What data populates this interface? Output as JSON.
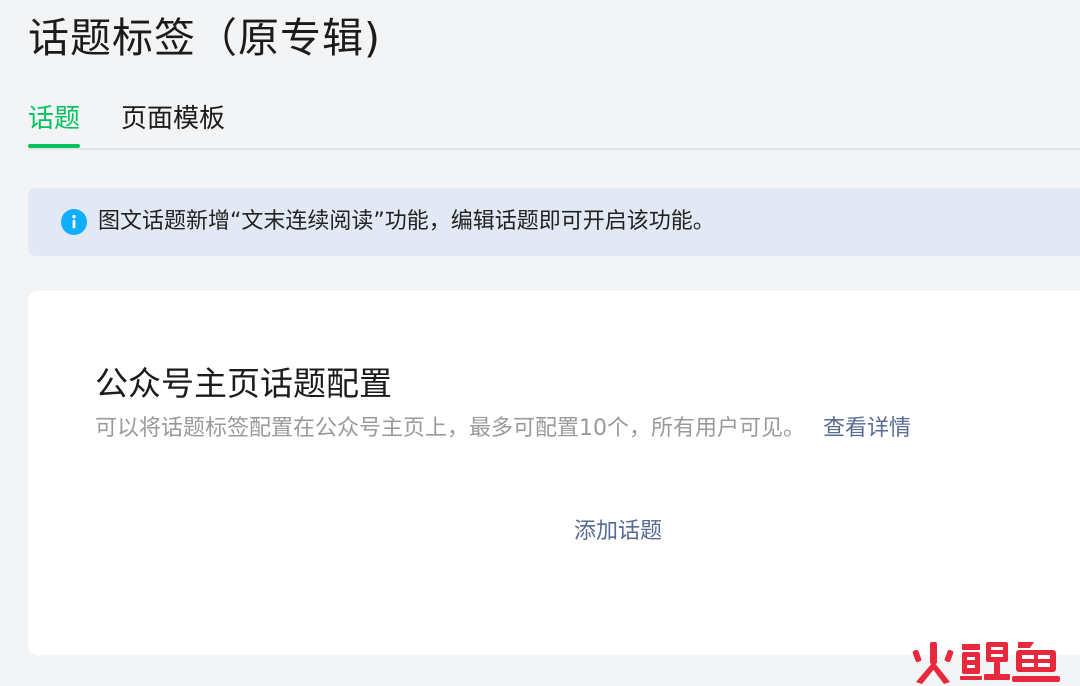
{
  "page": {
    "title": "话题标签（原专辑)"
  },
  "tabs": [
    {
      "label": "话题",
      "active": true
    },
    {
      "label": "页面模板",
      "active": false
    }
  ],
  "notice": {
    "icon": "info-icon",
    "text": "图文话题新增“文末连续阅读”功能，编辑话题即可开启该功能。"
  },
  "card": {
    "title": "公众号主页话题配置",
    "description": "可以将话题标签配置在公众号主页上，最多可配置10个，所有用户可见。",
    "details_link": "查看详情",
    "add_button": "添加话题"
  },
  "watermark": {
    "text": "火鲤鱼"
  },
  "colors": {
    "accent_green": "#07c160",
    "link_blue": "#576b95",
    "info_blue": "#10aeff",
    "notice_bg": "#e3e9f4",
    "watermark_red": "#e8283c"
  }
}
